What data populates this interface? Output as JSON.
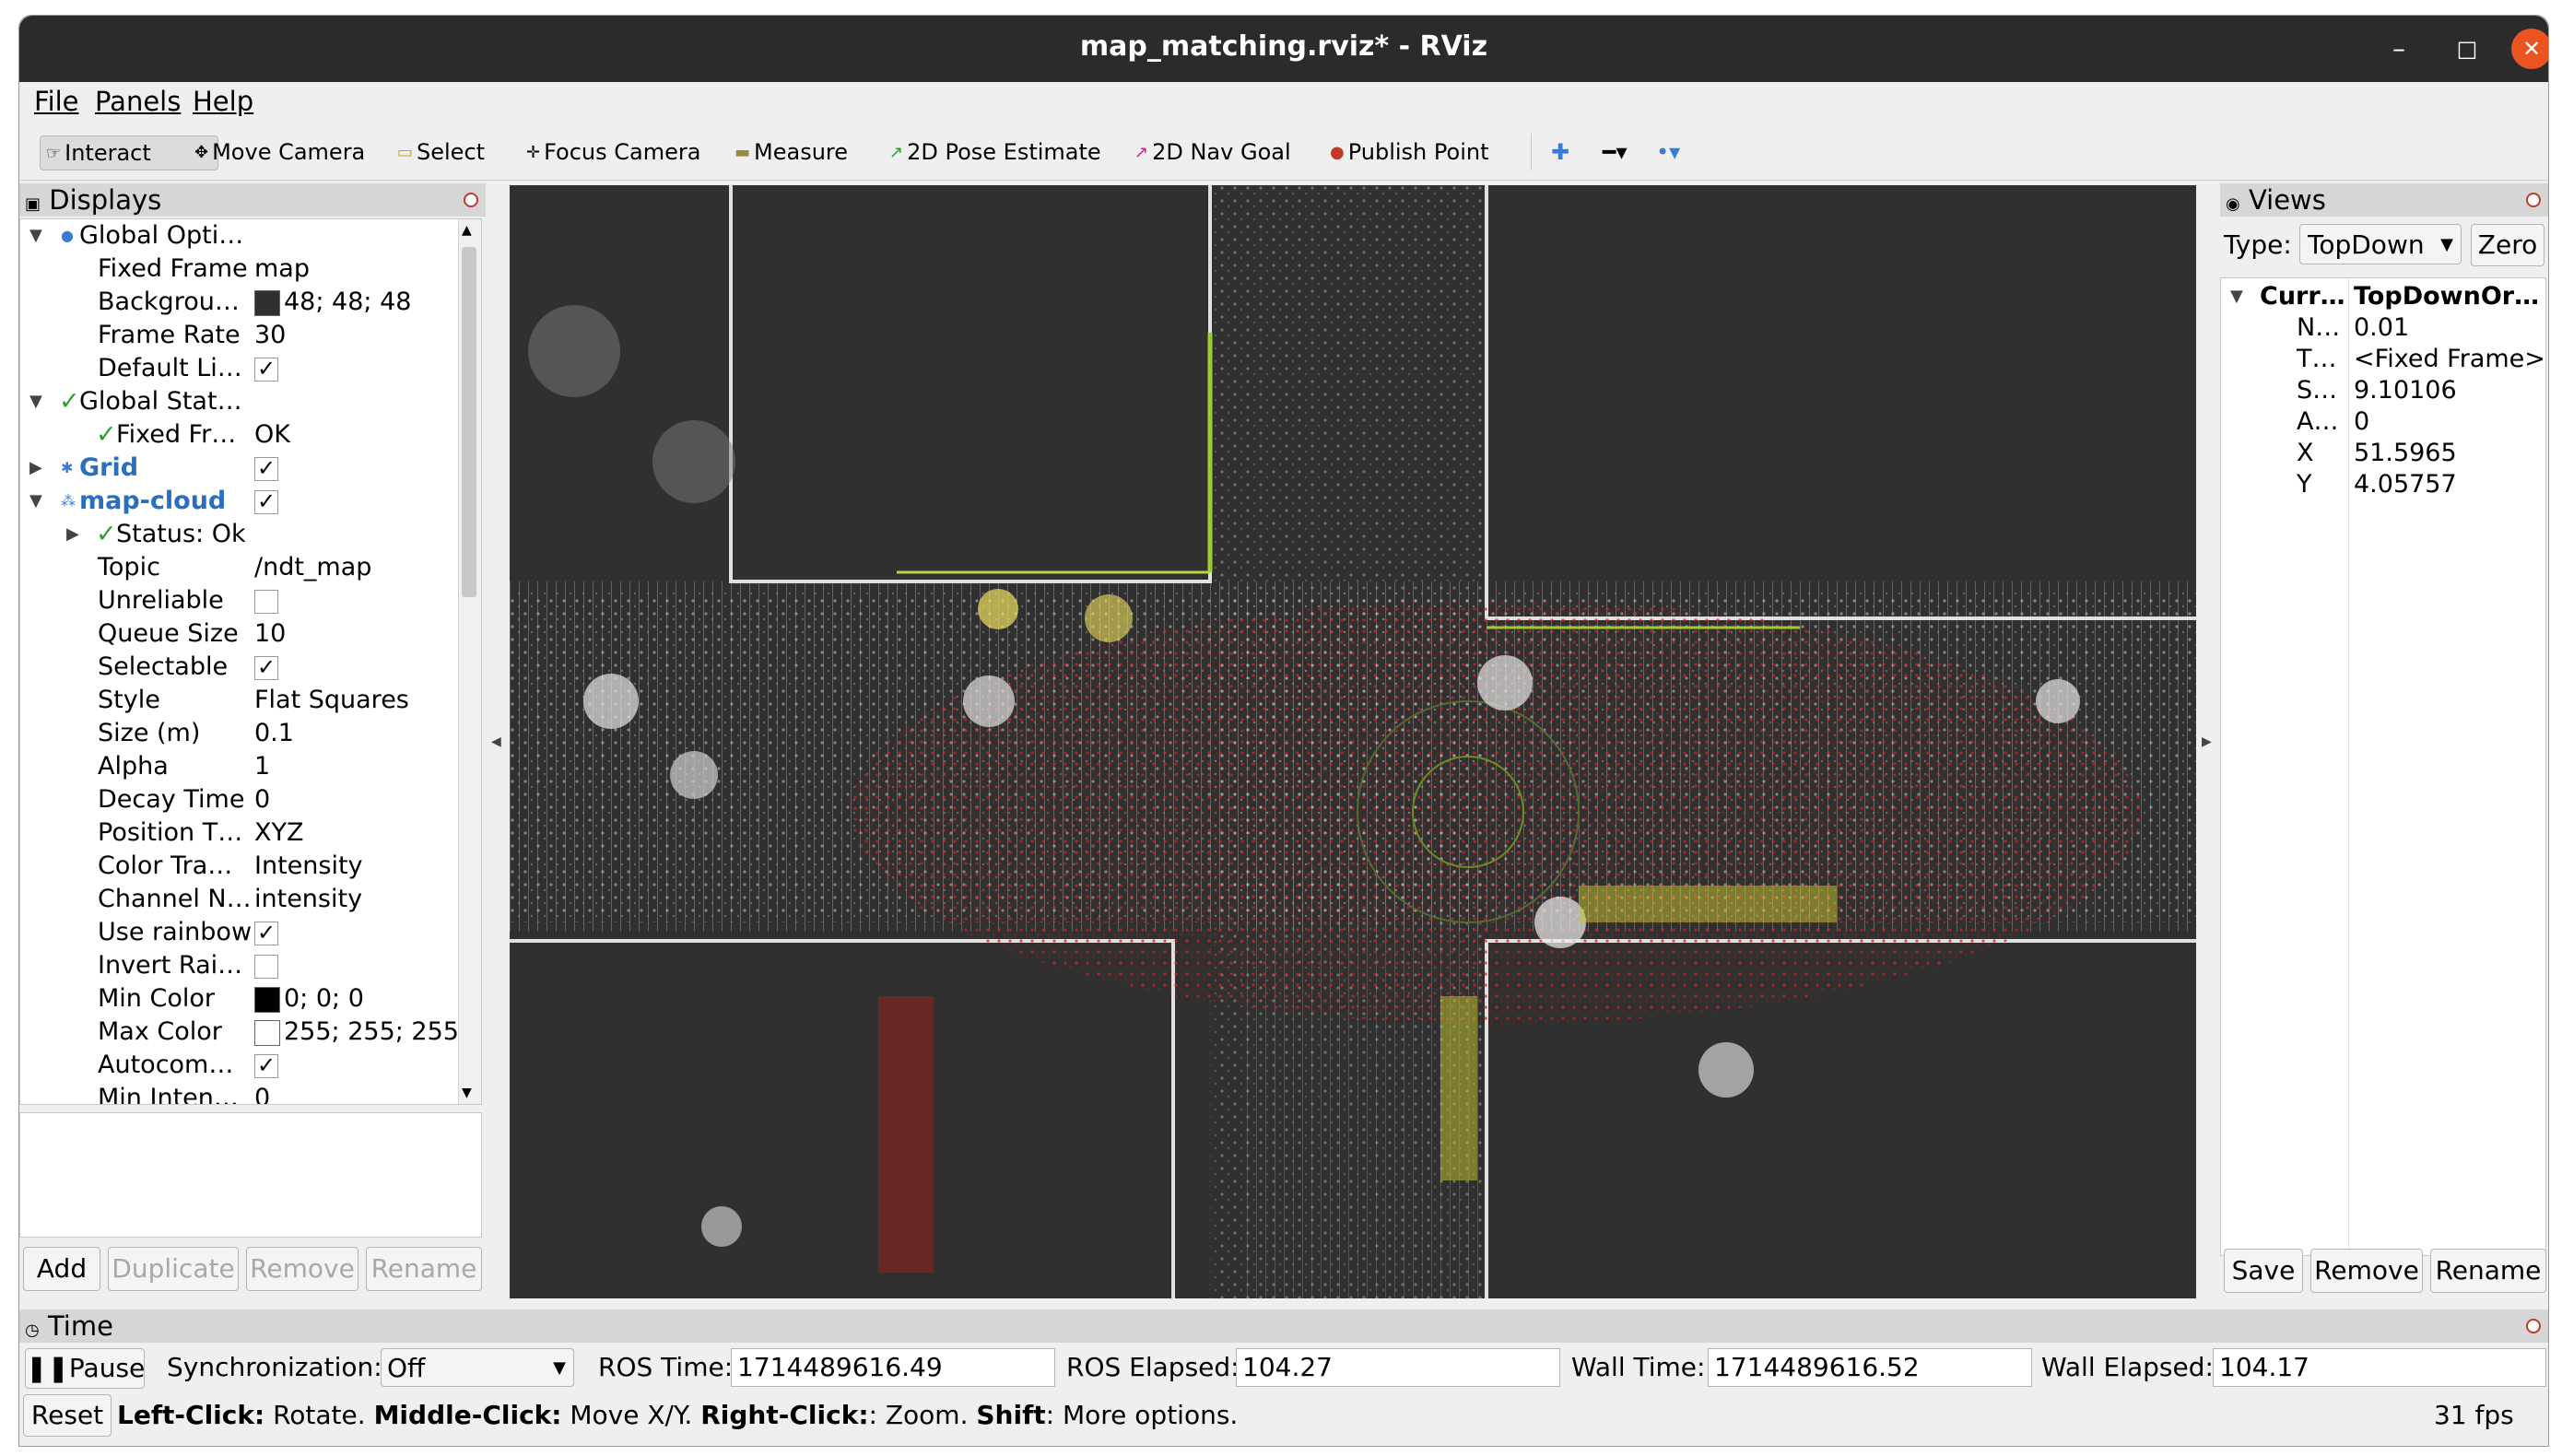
{
  "window": {
    "title": "map_matching.rviz* - RViz",
    "minimize": "–",
    "maximize": "□",
    "close": "✕"
  },
  "menu": [
    "File",
    "Panels",
    "Help"
  ],
  "toolbar": {
    "interact": "Interact",
    "move_camera": "Move Camera",
    "select": "Select",
    "focus_camera": "Focus Camera",
    "measure": "Measure",
    "pose_estimate": "2D Pose Estimate",
    "nav_goal": "2D Nav Goal",
    "publish_point": "Publish Point",
    "add_icon": "plus-icon",
    "remove_icon": "minus-icon",
    "options_icon": "dot-icon"
  },
  "displays": {
    "title": "Displays",
    "rows": [
      {
        "label": "Global Opti…",
        "value": ""
      },
      {
        "label": "Fixed Frame",
        "value": "map"
      },
      {
        "label": "Backgrou…",
        "value": "48; 48; 48"
      },
      {
        "label": "Frame Rate",
        "value": "30"
      },
      {
        "label": "Default Li…",
        "value": "✓"
      },
      {
        "label": "Global Stat…",
        "value": ""
      },
      {
        "label": "Fixed Fr…",
        "value": "OK"
      },
      {
        "label": "Grid",
        "value": "✓"
      },
      {
        "label": "map-cloud",
        "value": "✓"
      },
      {
        "label": "Status: Ok",
        "value": ""
      },
      {
        "label": "Topic",
        "value": "/ndt_map"
      },
      {
        "label": "Unreliable",
        "value": ""
      },
      {
        "label": "Queue Size",
        "value": "10"
      },
      {
        "label": "Selectable",
        "value": "✓"
      },
      {
        "label": "Style",
        "value": "Flat Squares"
      },
      {
        "label": "Size (m)",
        "value": "0.1"
      },
      {
        "label": "Alpha",
        "value": "1"
      },
      {
        "label": "Decay Time",
        "value": "0"
      },
      {
        "label": "Position T…",
        "value": "XYZ"
      },
      {
        "label": "Color Tra…",
        "value": "Intensity"
      },
      {
        "label": "Channel N…",
        "value": "intensity"
      },
      {
        "label": "Use rainbow",
        "value": "✓"
      },
      {
        "label": "Invert Rai…",
        "value": ""
      },
      {
        "label": "Min Color",
        "value": "0; 0; 0"
      },
      {
        "label": "Max Color",
        "value": "255; 255; 255"
      },
      {
        "label": "Autocom…",
        "value": "✓"
      },
      {
        "label": "Min Inten…",
        "value": "0"
      }
    ],
    "buttons": {
      "add": "Add",
      "duplicate": "Duplicate",
      "remove": "Remove",
      "rename": "Rename"
    },
    "colors": {
      "background": "#303030",
      "min": "#000000",
      "max": "#ffffff"
    }
  },
  "views": {
    "title": "Views",
    "type_label": "Type:",
    "type_value": "TopDown",
    "zero": "Zero",
    "rows": [
      {
        "label": "Curr…",
        "value": "TopDownOr…"
      },
      {
        "label": "N…",
        "value": "0.01"
      },
      {
        "label": "T…",
        "value": "<Fixed Frame>"
      },
      {
        "label": "S…",
        "value": "9.10106"
      },
      {
        "label": "A…",
        "value": "0"
      },
      {
        "label": "X",
        "value": "51.5965"
      },
      {
        "label": "Y",
        "value": "4.05757"
      }
    ],
    "buttons": {
      "save": "Save",
      "remove": "Remove",
      "rename": "Rename"
    }
  },
  "time": {
    "title": "Time",
    "pause": "Pause",
    "sync_label": "Synchronization:",
    "sync_value": "Off",
    "ros_time_label": "ROS Time:",
    "ros_time": "1714489616.49",
    "ros_elapsed_label": "ROS Elapsed:",
    "ros_elapsed": "104.27",
    "wall_time_label": "Wall Time:",
    "wall_time": "1714489616.52",
    "wall_elapsed_label": "Wall Elapsed:",
    "wall_elapsed": "104.17"
  },
  "status": {
    "reset": "Reset",
    "b1": "Left-Click:",
    "t1": " Rotate. ",
    "b2": "Middle-Click:",
    "t2": " Move X/Y. ",
    "b3": "Right-Click:",
    "t3": ": Zoom. ",
    "b4": "Shift",
    "t4": ": More options.",
    "fps": "31 fps"
  }
}
